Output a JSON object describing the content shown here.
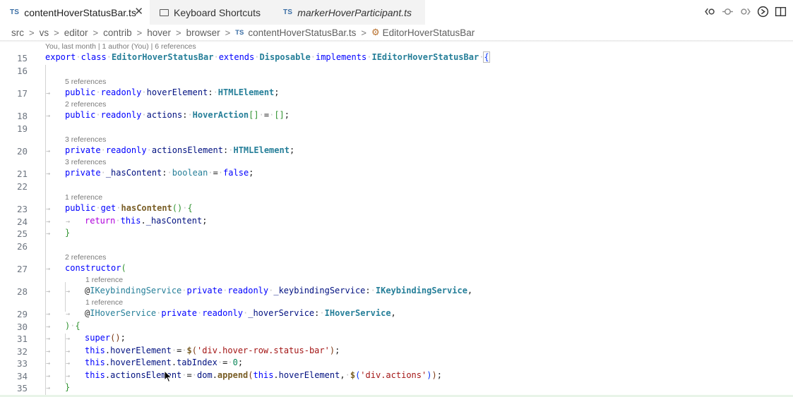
{
  "tabs": [
    {
      "icon": "ts-file-icon",
      "badge": "TS",
      "label": "contentHoverStatusBar.ts",
      "active": true
    },
    {
      "icon": "keyboard-icon",
      "label": "Keyboard Shortcuts",
      "active": false
    },
    {
      "icon": "ts-file-icon",
      "badge": "TS",
      "label": "markerHoverParticipant.ts",
      "active": false,
      "italic": true
    }
  ],
  "toolbar_actions": [
    "go-back-icon",
    "toggle-breakpoint-icon",
    "go-forward-icon",
    "copilot-icon",
    "split-editor-icon"
  ],
  "breadcrumb": [
    "src",
    "vs",
    "editor",
    "contrib",
    "hover",
    "browser",
    "contentHoverStatusBar.ts",
    "EditorHoverStatusBar"
  ],
  "breadcrumb_ts_badge": "TS",
  "codelens": {
    "l15": "You, last month | 1 author (You) | 6 references",
    "l17": "5 references",
    "l18": "2 references",
    "l20": "3 references",
    "l21": "3 references",
    "l23": "1 reference",
    "l27": "2 references",
    "l28": "1 reference",
    "l29": "1 reference"
  },
  "line_numbers": [
    "15",
    "16",
    "17",
    "18",
    "19",
    "20",
    "21",
    "22",
    "23",
    "24",
    "25",
    "26",
    "27",
    "28",
    "29",
    "30",
    "31",
    "32",
    "33",
    "34",
    "35"
  ],
  "tokens": {
    "export": "export",
    "class": "class",
    "EditorHoverStatusBar": "EditorHoverStatusBar",
    "extends": "extends",
    "Disposable": "Disposable",
    "implements": "implements",
    "IEditorHoverStatusBar": "IEditorHoverStatusBar",
    "public": "public",
    "private": "private",
    "readonly": "readonly",
    "hoverElement": "hoverElement",
    "HTMLElement": "HTMLElement",
    "actions": "actions",
    "HoverAction": "HoverAction",
    "actionsElement": "actionsElement",
    "_hasContent": "_hasContent",
    "boolean": "boolean",
    "false": "false",
    "get": "get",
    "hasContent": "hasContent",
    "return": "return",
    "this": "this",
    "constructor": "constructor",
    "IKeybindingService": "IKeybindingService",
    "_keybindingService": "_keybindingService",
    "IHoverService": "IHoverService",
    "_hoverService": "_hoverService",
    "super": "super",
    "tabIndex": "tabIndex",
    "zero": "0",
    "str_statusbar": "'div.hover-row.status-bar'",
    "dom": "dom",
    "append": "append",
    "str_actions": "'div.actions'"
  }
}
